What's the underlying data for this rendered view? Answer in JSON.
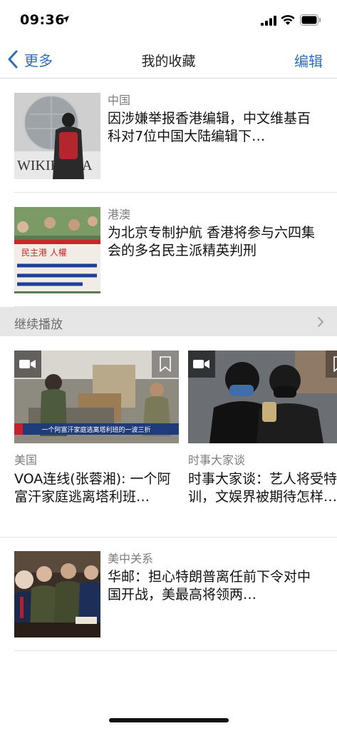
{
  "status_bar": {
    "time": "09:36",
    "icons": [
      "location-arrow-icon",
      "cellular-signal-icon",
      "wifi-icon",
      "battery-icon"
    ]
  },
  "nav": {
    "back_label": "更多",
    "title": "我的收藏",
    "edit_label": "编辑"
  },
  "articles": [
    {
      "category": "中国",
      "headline": "因涉嫌举报香港编辑，中文维基百科对7位中国大陆编辑下…",
      "thumb_text": "WIKIPEDIA"
    },
    {
      "category": "港澳",
      "headline": "为北京专制护航 香港将参与六四集会的多名民主派精英判刑",
      "thumb_text": "民主港 人權"
    },
    {
      "category": "美中关系",
      "headline": "华邮：担心特朗普离任前下令对中国开战，美最高将领两…"
    }
  ],
  "continue_section": {
    "title": "继续播放"
  },
  "videos": [
    {
      "category": "美国",
      "headline": "VOA连线(张蓉湘): 一个阿富汗家庭逃离塔利班…",
      "caption": "一个阿富汗家庭逃离塔利班的一波三折"
    },
    {
      "category": "时事大家谈",
      "headline": "时事大家谈：艺人将受特训，文娱界被期待怎样…",
      "caption": ""
    }
  ],
  "colors": {
    "accent": "#2f6fb5",
    "category_gray": "#7d7d7d",
    "section_bg": "#e6e6e6",
    "divider": "#e3e3e3"
  }
}
